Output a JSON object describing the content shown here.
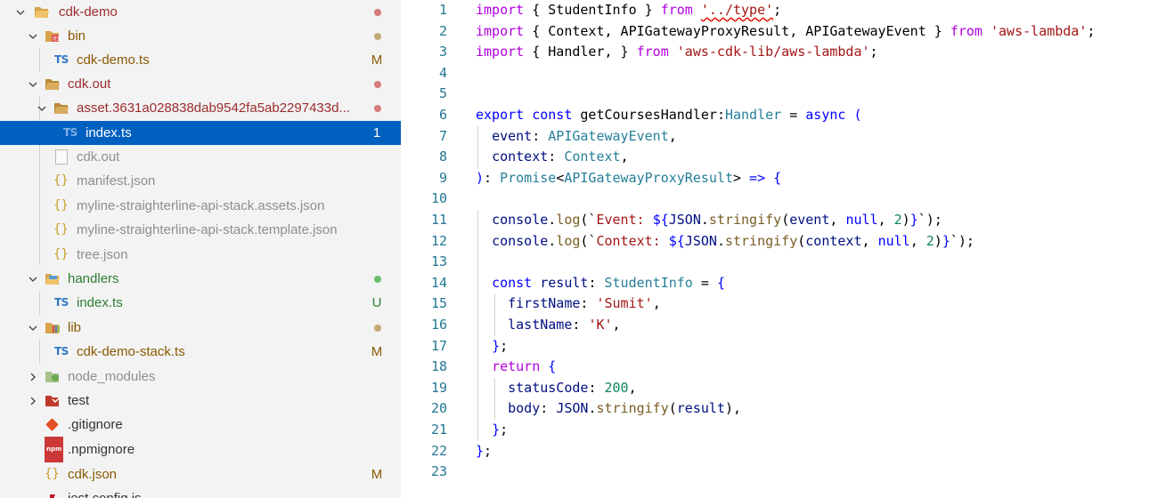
{
  "explorer": {
    "items": [
      {
        "label": "cdk-demo",
        "decoration": "dot",
        "deco_color": "#d97a7a",
        "label_color": "#9b2c2c",
        "icon": "folder-open-icon"
      },
      {
        "label": "bin",
        "decoration": "dot",
        "deco_color": "#c2a978",
        "label_color": "#8a5a00",
        "icon": "folder-bin-icon"
      },
      {
        "label": "cdk-demo.ts",
        "decoration": "M",
        "deco_color": "#8a5a00",
        "label_color": "#8a5a00",
        "icon": "typescript-icon"
      },
      {
        "label": "cdk.out",
        "decoration": "dot",
        "deco_color": "#d97a7a",
        "label_color": "#9b2c2c",
        "icon": "folder-open-icon"
      },
      {
        "label": "asset.3631a028838dab9542fa5ab2297433d...",
        "decoration": "dot",
        "deco_color": "#d97a7a",
        "label_color": "#9b2c2c",
        "icon": "folder-open-icon"
      },
      {
        "label": "index.ts",
        "decoration": "1",
        "deco_color": "#ffffff",
        "label_color": "#ffffff",
        "icon": "typescript-icon"
      },
      {
        "label": "cdk.out",
        "decoration": "",
        "deco_color": "",
        "label_color": "#8e8e8e",
        "icon": "file-icon"
      },
      {
        "label": "manifest.json",
        "decoration": "",
        "deco_color": "",
        "label_color": "#8e8e8e",
        "icon": "json-icon"
      },
      {
        "label": "myline-straighterline-api-stack.assets.json",
        "decoration": "",
        "deco_color": "",
        "label_color": "#8e8e8e",
        "icon": "json-icon"
      },
      {
        "label": "myline-straighterline-api-stack.template.json",
        "decoration": "",
        "deco_color": "",
        "label_color": "#8e8e8e",
        "icon": "json-icon"
      },
      {
        "label": "tree.json",
        "decoration": "",
        "deco_color": "",
        "label_color": "#8e8e8e",
        "icon": "json-icon"
      },
      {
        "label": "handlers",
        "decoration": "dot",
        "deco_color": "#6cbf6c",
        "label_color": "#2e7d32",
        "icon": "folder-handlers-icon"
      },
      {
        "label": "index.ts",
        "decoration": "U",
        "deco_color": "#2e7d32",
        "label_color": "#2e7d32",
        "icon": "typescript-icon"
      },
      {
        "label": "lib",
        "decoration": "dot",
        "deco_color": "#c2a978",
        "label_color": "#8a5a00",
        "icon": "folder-lib-icon"
      },
      {
        "label": "cdk-demo-stack.ts",
        "decoration": "M",
        "deco_color": "#8a5a00",
        "label_color": "#8a5a00",
        "icon": "typescript-icon"
      },
      {
        "label": "node_modules",
        "decoration": "",
        "deco_color": "",
        "label_color": "#8e8e8e",
        "icon": "folder-node-icon"
      },
      {
        "label": "test",
        "decoration": "",
        "deco_color": "",
        "label_color": "#333333",
        "icon": "folder-test-icon"
      },
      {
        "label": ".gitignore",
        "decoration": "",
        "deco_color": "",
        "label_color": "#333333",
        "icon": "git-icon"
      },
      {
        "label": ".npmignore",
        "decoration": "",
        "deco_color": "",
        "label_color": "#333333",
        "icon": "npm-icon"
      },
      {
        "label": "cdk.json",
        "decoration": "M",
        "deco_color": "#8a5a00",
        "label_color": "#8a5a00",
        "icon": "json-icon"
      },
      {
        "label": "jest.config.js",
        "decoration": "",
        "deco_color": "",
        "label_color": "#333333",
        "icon": "jest-icon"
      }
    ]
  },
  "editor": {
    "line_numbers": [
      "1",
      "2",
      "3",
      "4",
      "5",
      "6",
      "7",
      "8",
      "9",
      "10",
      "11",
      "12",
      "13",
      "14",
      "15",
      "16",
      "17",
      "18",
      "19",
      "20",
      "21",
      "22",
      "23"
    ],
    "lines": [
      [
        {
          "t": "import",
          "c": "kw2"
        },
        {
          "t": " { StudentInfo } ",
          "c": ""
        },
        {
          "t": "from",
          "c": "kw2"
        },
        {
          "t": " ",
          "c": ""
        },
        {
          "t": "'../type'",
          "c": "str sq"
        },
        {
          "t": ";",
          "c": ""
        }
      ],
      [
        {
          "t": "import",
          "c": "kw2"
        },
        {
          "t": " { Context, APIGatewayProxyResult, APIGatewayEvent } ",
          "c": ""
        },
        {
          "t": "from",
          "c": "kw2"
        },
        {
          "t": " ",
          "c": ""
        },
        {
          "t": "'aws-lambda'",
          "c": "str"
        },
        {
          "t": ";",
          "c": ""
        }
      ],
      [
        {
          "t": "import",
          "c": "kw2"
        },
        {
          "t": " { Handler, } ",
          "c": ""
        },
        {
          "t": "from",
          "c": "kw2"
        },
        {
          "t": " ",
          "c": ""
        },
        {
          "t": "'aws-cdk-lib/aws-lambda'",
          "c": "str"
        },
        {
          "t": ";",
          "c": ""
        }
      ],
      [],
      [],
      [
        {
          "t": "export",
          "c": "kw"
        },
        {
          "t": " ",
          "c": ""
        },
        {
          "t": "const",
          "c": "kw"
        },
        {
          "t": " ",
          "c": ""
        },
        {
          "t": "getCoursesHandler",
          "c": ""
        },
        {
          "t": ":",
          "c": ""
        },
        {
          "t": "Handler",
          "c": "ty"
        },
        {
          "t": " = ",
          "c": ""
        },
        {
          "t": "async",
          "c": "kw"
        },
        {
          "t": " (",
          "c": "kw"
        }
      ],
      [
        {
          "t": "  ",
          "c": ""
        },
        {
          "t": "event",
          "c": "var"
        },
        {
          "t": ": ",
          "c": ""
        },
        {
          "t": "APIGatewayEvent",
          "c": "ty"
        },
        {
          "t": ",",
          "c": ""
        }
      ],
      [
        {
          "t": "  ",
          "c": ""
        },
        {
          "t": "context",
          "c": "var"
        },
        {
          "t": ": ",
          "c": ""
        },
        {
          "t": "Context",
          "c": "ty"
        },
        {
          "t": ",",
          "c": ""
        }
      ],
      [
        {
          "t": ")",
          "c": "kw"
        },
        {
          "t": ": ",
          "c": ""
        },
        {
          "t": "Promise",
          "c": "ty"
        },
        {
          "t": "<",
          "c": ""
        },
        {
          "t": "APIGatewayProxyResult",
          "c": "ty"
        },
        {
          "t": ">",
          "c": ""
        },
        {
          "t": " => ",
          "c": "kw"
        },
        {
          "t": "{",
          "c": "kw"
        }
      ],
      [],
      [
        {
          "t": "  ",
          "c": ""
        },
        {
          "t": "console",
          "c": "var"
        },
        {
          "t": ".",
          "c": ""
        },
        {
          "t": "log",
          "c": "fn"
        },
        {
          "t": "(`",
          "c": ""
        },
        {
          "t": "Event: ",
          "c": "str"
        },
        {
          "t": "${",
          "c": "kw"
        },
        {
          "t": "JSON",
          "c": "var"
        },
        {
          "t": ".",
          "c": ""
        },
        {
          "t": "stringify",
          "c": "fn"
        },
        {
          "t": "(",
          "c": ""
        },
        {
          "t": "event",
          "c": "var"
        },
        {
          "t": ", ",
          "c": ""
        },
        {
          "t": "null",
          "c": "kw"
        },
        {
          "t": ", ",
          "c": ""
        },
        {
          "t": "2",
          "c": "num"
        },
        {
          "t": ")",
          "c": ""
        },
        {
          "t": "}",
          "c": "kw"
        },
        {
          "t": "`);",
          "c": ""
        }
      ],
      [
        {
          "t": "  ",
          "c": ""
        },
        {
          "t": "console",
          "c": "var"
        },
        {
          "t": ".",
          "c": ""
        },
        {
          "t": "log",
          "c": "fn"
        },
        {
          "t": "(`",
          "c": ""
        },
        {
          "t": "Context: ",
          "c": "str"
        },
        {
          "t": "${",
          "c": "kw"
        },
        {
          "t": "JSON",
          "c": "var"
        },
        {
          "t": ".",
          "c": ""
        },
        {
          "t": "stringify",
          "c": "fn"
        },
        {
          "t": "(",
          "c": ""
        },
        {
          "t": "context",
          "c": "var"
        },
        {
          "t": ", ",
          "c": ""
        },
        {
          "t": "null",
          "c": "kw"
        },
        {
          "t": ", ",
          "c": ""
        },
        {
          "t": "2",
          "c": "num"
        },
        {
          "t": ")",
          "c": ""
        },
        {
          "t": "}",
          "c": "kw"
        },
        {
          "t": "`);",
          "c": ""
        }
      ],
      [],
      [
        {
          "t": "  ",
          "c": ""
        },
        {
          "t": "const",
          "c": "kw"
        },
        {
          "t": " ",
          "c": ""
        },
        {
          "t": "result",
          "c": "var"
        },
        {
          "t": ": ",
          "c": ""
        },
        {
          "t": "StudentInfo",
          "c": "ty"
        },
        {
          "t": " = ",
          "c": ""
        },
        {
          "t": "{",
          "c": "kw"
        }
      ],
      [
        {
          "t": "    ",
          "c": ""
        },
        {
          "t": "firstName",
          "c": "var"
        },
        {
          "t": ": ",
          "c": ""
        },
        {
          "t": "'Sumit'",
          "c": "str"
        },
        {
          "t": ",",
          "c": ""
        }
      ],
      [
        {
          "t": "    ",
          "c": ""
        },
        {
          "t": "lastName",
          "c": "var"
        },
        {
          "t": ": ",
          "c": ""
        },
        {
          "t": "'K'",
          "c": "str"
        },
        {
          "t": ",",
          "c": ""
        }
      ],
      [
        {
          "t": "  ",
          "c": ""
        },
        {
          "t": "}",
          "c": "kw"
        },
        {
          "t": ";",
          "c": ""
        }
      ],
      [
        {
          "t": "  ",
          "c": ""
        },
        {
          "t": "return",
          "c": "kw2"
        },
        {
          "t": " ",
          "c": ""
        },
        {
          "t": "{",
          "c": "kw"
        }
      ],
      [
        {
          "t": "    ",
          "c": ""
        },
        {
          "t": "statusCode",
          "c": "var"
        },
        {
          "t": ": ",
          "c": ""
        },
        {
          "t": "200",
          "c": "num"
        },
        {
          "t": ",",
          "c": ""
        }
      ],
      [
        {
          "t": "    ",
          "c": ""
        },
        {
          "t": "body",
          "c": "var"
        },
        {
          "t": ": ",
          "c": ""
        },
        {
          "t": "JSON",
          "c": "var"
        },
        {
          "t": ".",
          "c": ""
        },
        {
          "t": "stringify",
          "c": "fn"
        },
        {
          "t": "(",
          "c": ""
        },
        {
          "t": "result",
          "c": "var"
        },
        {
          "t": "),",
          "c": ""
        }
      ],
      [
        {
          "t": "  ",
          "c": ""
        },
        {
          "t": "}",
          "c": "kw"
        },
        {
          "t": ";",
          "c": ""
        }
      ],
      [
        {
          "t": "}",
          "c": "kw"
        },
        {
          "t": ";",
          "c": ""
        }
      ],
      []
    ]
  }
}
